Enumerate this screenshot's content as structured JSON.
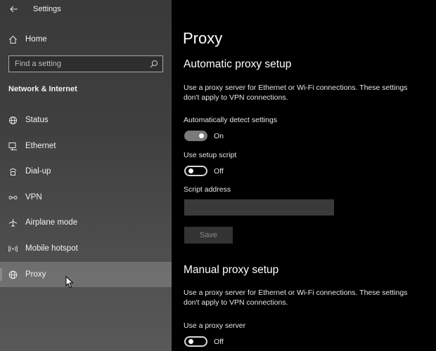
{
  "window": {
    "title": "Settings"
  },
  "sidebar": {
    "home_label": "Home",
    "search_placeholder": "Find a setting",
    "section_heading": "Network & Internet",
    "items": [
      {
        "label": "Status",
        "icon": "globe-status-icon"
      },
      {
        "label": "Ethernet",
        "icon": "ethernet-icon"
      },
      {
        "label": "Dial-up",
        "icon": "dialup-icon"
      },
      {
        "label": "VPN",
        "icon": "vpn-icon"
      },
      {
        "label": "Airplane mode",
        "icon": "airplane-icon"
      },
      {
        "label": "Mobile hotspot",
        "icon": "hotspot-icon"
      },
      {
        "label": "Proxy",
        "icon": "globe-icon",
        "selected": true
      }
    ]
  },
  "main": {
    "title": "Proxy",
    "automatic": {
      "heading": "Automatic proxy setup",
      "description": "Use a proxy server for Ethernet or Wi-Fi connections. These settings don't apply to VPN connections.",
      "detect_label": "Automatically detect settings",
      "detect_state": "On",
      "script_label": "Use setup script",
      "script_state": "Off",
      "address_label": "Script address",
      "address_value": "",
      "save_label": "Save"
    },
    "manual": {
      "heading": "Manual proxy setup",
      "description": "Use a proxy server for Ethernet or Wi-Fi connections. These settings don't apply to VPN connections.",
      "use_proxy_label": "Use a proxy server",
      "use_proxy_state": "Off"
    }
  },
  "colors": {
    "sidebar_top": "#3a3a3a",
    "sidebar_bottom": "#595959",
    "main_bg": "#000000",
    "toggle_on": "#7a7a7a"
  }
}
